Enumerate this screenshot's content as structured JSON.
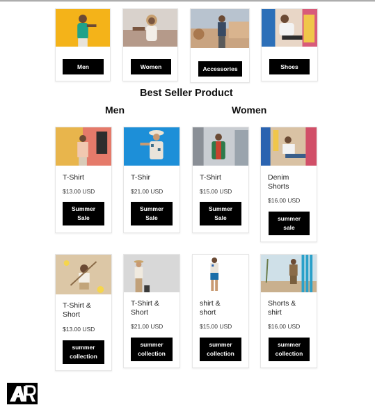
{
  "categories": [
    {
      "button": "Men"
    },
    {
      "button": "Women"
    },
    {
      "button": "Accessories"
    },
    {
      "button": "Shoes"
    }
  ],
  "section_title": "Best Seller Product",
  "group_labels": {
    "men": "Men",
    "women": "Women"
  },
  "products_row1": [
    {
      "title": "T-Shirt",
      "price": "$13.00 USD",
      "button": "Summer\nSale"
    },
    {
      "title": "T-Shir",
      "price": "$21.00 USD",
      "button": "Summer\nSale"
    },
    {
      "title": "T-Shirt",
      "price": "$15.00 USD",
      "button": "Summer\nSale"
    },
    {
      "title": "Denim\nShorts",
      "price": "$16.00 USD",
      "button": "summer\nsale"
    }
  ],
  "products_row2": [
    {
      "title": "T-Shirt &\nShort",
      "price": "$13.00 USD",
      "button": "summer\ncollection"
    },
    {
      "title": "T-Shirt &\nShort",
      "price": "$21.00 USD",
      "button": "summer\ncollection"
    },
    {
      "title": "shirt &\nshort",
      "price": "$15.00 USD",
      "button": "summer\ncollection"
    },
    {
      "title": "Shorts &\nshirt",
      "price": "$16.00 USD",
      "button": "summer\ncollection"
    }
  ],
  "logo_text": "AR",
  "colors": {
    "button_bg": "#000000",
    "button_text": "#ffffff",
    "card_border": "#e6e6e6"
  }
}
